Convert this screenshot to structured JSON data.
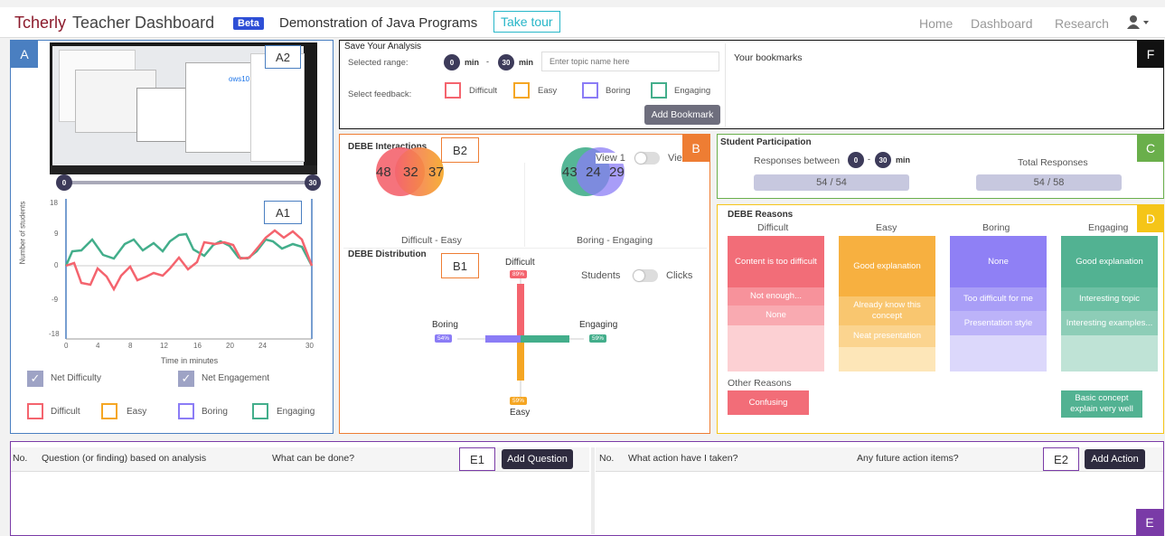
{
  "app": {
    "brand": "Tcherly",
    "title": "Teacher Dashboard",
    "badge": "Beta",
    "course": "Demonstration of Java Programs",
    "tour": "Take tour"
  },
  "nav": {
    "home": "Home",
    "dashboard": "Dashboard",
    "research": "Research"
  },
  "colors": {
    "difficult": "#f4646e",
    "easy": "#f5a623",
    "boring": "#8b7cf6",
    "engaging": "#43ae8b",
    "brand": "#8b1a2b",
    "accent": "#27b6c8"
  },
  "tags": {
    "A": "A",
    "A1": "A1",
    "A2": "A2",
    "B": "B",
    "B1": "B1",
    "B2": "B2",
    "C": "C",
    "D": "D",
    "E": "E",
    "E1": "E1",
    "E2": "E2",
    "F": "F"
  },
  "video": {
    "start": "0",
    "end": "30",
    "screen_text": "ows10"
  },
  "timeline": {
    "ylabel": "Number of students",
    "xlabel": "Time in minutes",
    "yticks": [
      "18",
      "9",
      "0",
      "-9",
      "-18"
    ],
    "xticks": [
      "0",
      "4",
      "8",
      "12",
      "16",
      "20",
      "24",
      "30"
    ]
  },
  "legend": {
    "net_difficulty": "Net Difficulty",
    "net_engagement": "Net Engagement",
    "difficult": "Difficult",
    "easy": "Easy",
    "boring": "Boring",
    "engaging": "Engaging"
  },
  "save": {
    "title": "Save Your Analysis",
    "range_label": "Selected range:",
    "from": "0",
    "to": "30",
    "unit": "min",
    "placeholder": "Enter topic name here",
    "feedback_label": "Select feedback:",
    "add": "Add Bookmark",
    "bookmarks": "Your bookmarks"
  },
  "interactions": {
    "title": "DEBE Interactions",
    "view1": "View 1",
    "view2": "Vie",
    "de_left": "48",
    "de_mid": "32",
    "de_right": "37",
    "be_left": "43",
    "be_mid": "24",
    "be_right": "29",
    "de_label": "Difficult - Easy",
    "be_label": "Boring - Engaging"
  },
  "distribution": {
    "title": "DEBE Distribution",
    "students": "Students",
    "clicks": "Clicks",
    "difficult": "Difficult",
    "easy": "Easy",
    "boring": "Boring",
    "engaging": "Engaging",
    "difficult_pct": "89%",
    "easy_pct": "59%",
    "boring_pct": "54%",
    "engaging_pct": "59%"
  },
  "participation": {
    "title": "Student Participation",
    "between": "Responses between",
    "from": "0",
    "to": "30",
    "unit": "min",
    "total": "Total Responses",
    "responses": "54 / 54",
    "total_value": "54 / 58"
  },
  "reasons": {
    "title": "DEBE Reasons",
    "other": "Other Reasons",
    "difficult": [
      "Content is too difficult",
      "Not enough...",
      "None"
    ],
    "easy": [
      "Good explanation",
      "Already know this concept",
      "Neat presentation"
    ],
    "boring": [
      "None",
      "Too difficult for me",
      "Presentation style"
    ],
    "engaging": [
      "Good explanation",
      "Interesting topic",
      "Interesting examples..."
    ],
    "other_difficult": "Confusing",
    "other_engaging": "Basic concept explain very well"
  },
  "questions": {
    "no": "No.",
    "question": "Question (or finding) based on analysis",
    "todo": "What can be done?",
    "add": "Add Question"
  },
  "actions": {
    "no": "No.",
    "taken": "What action have I taken?",
    "future": "Any future action items?",
    "add": "Add Action"
  }
}
